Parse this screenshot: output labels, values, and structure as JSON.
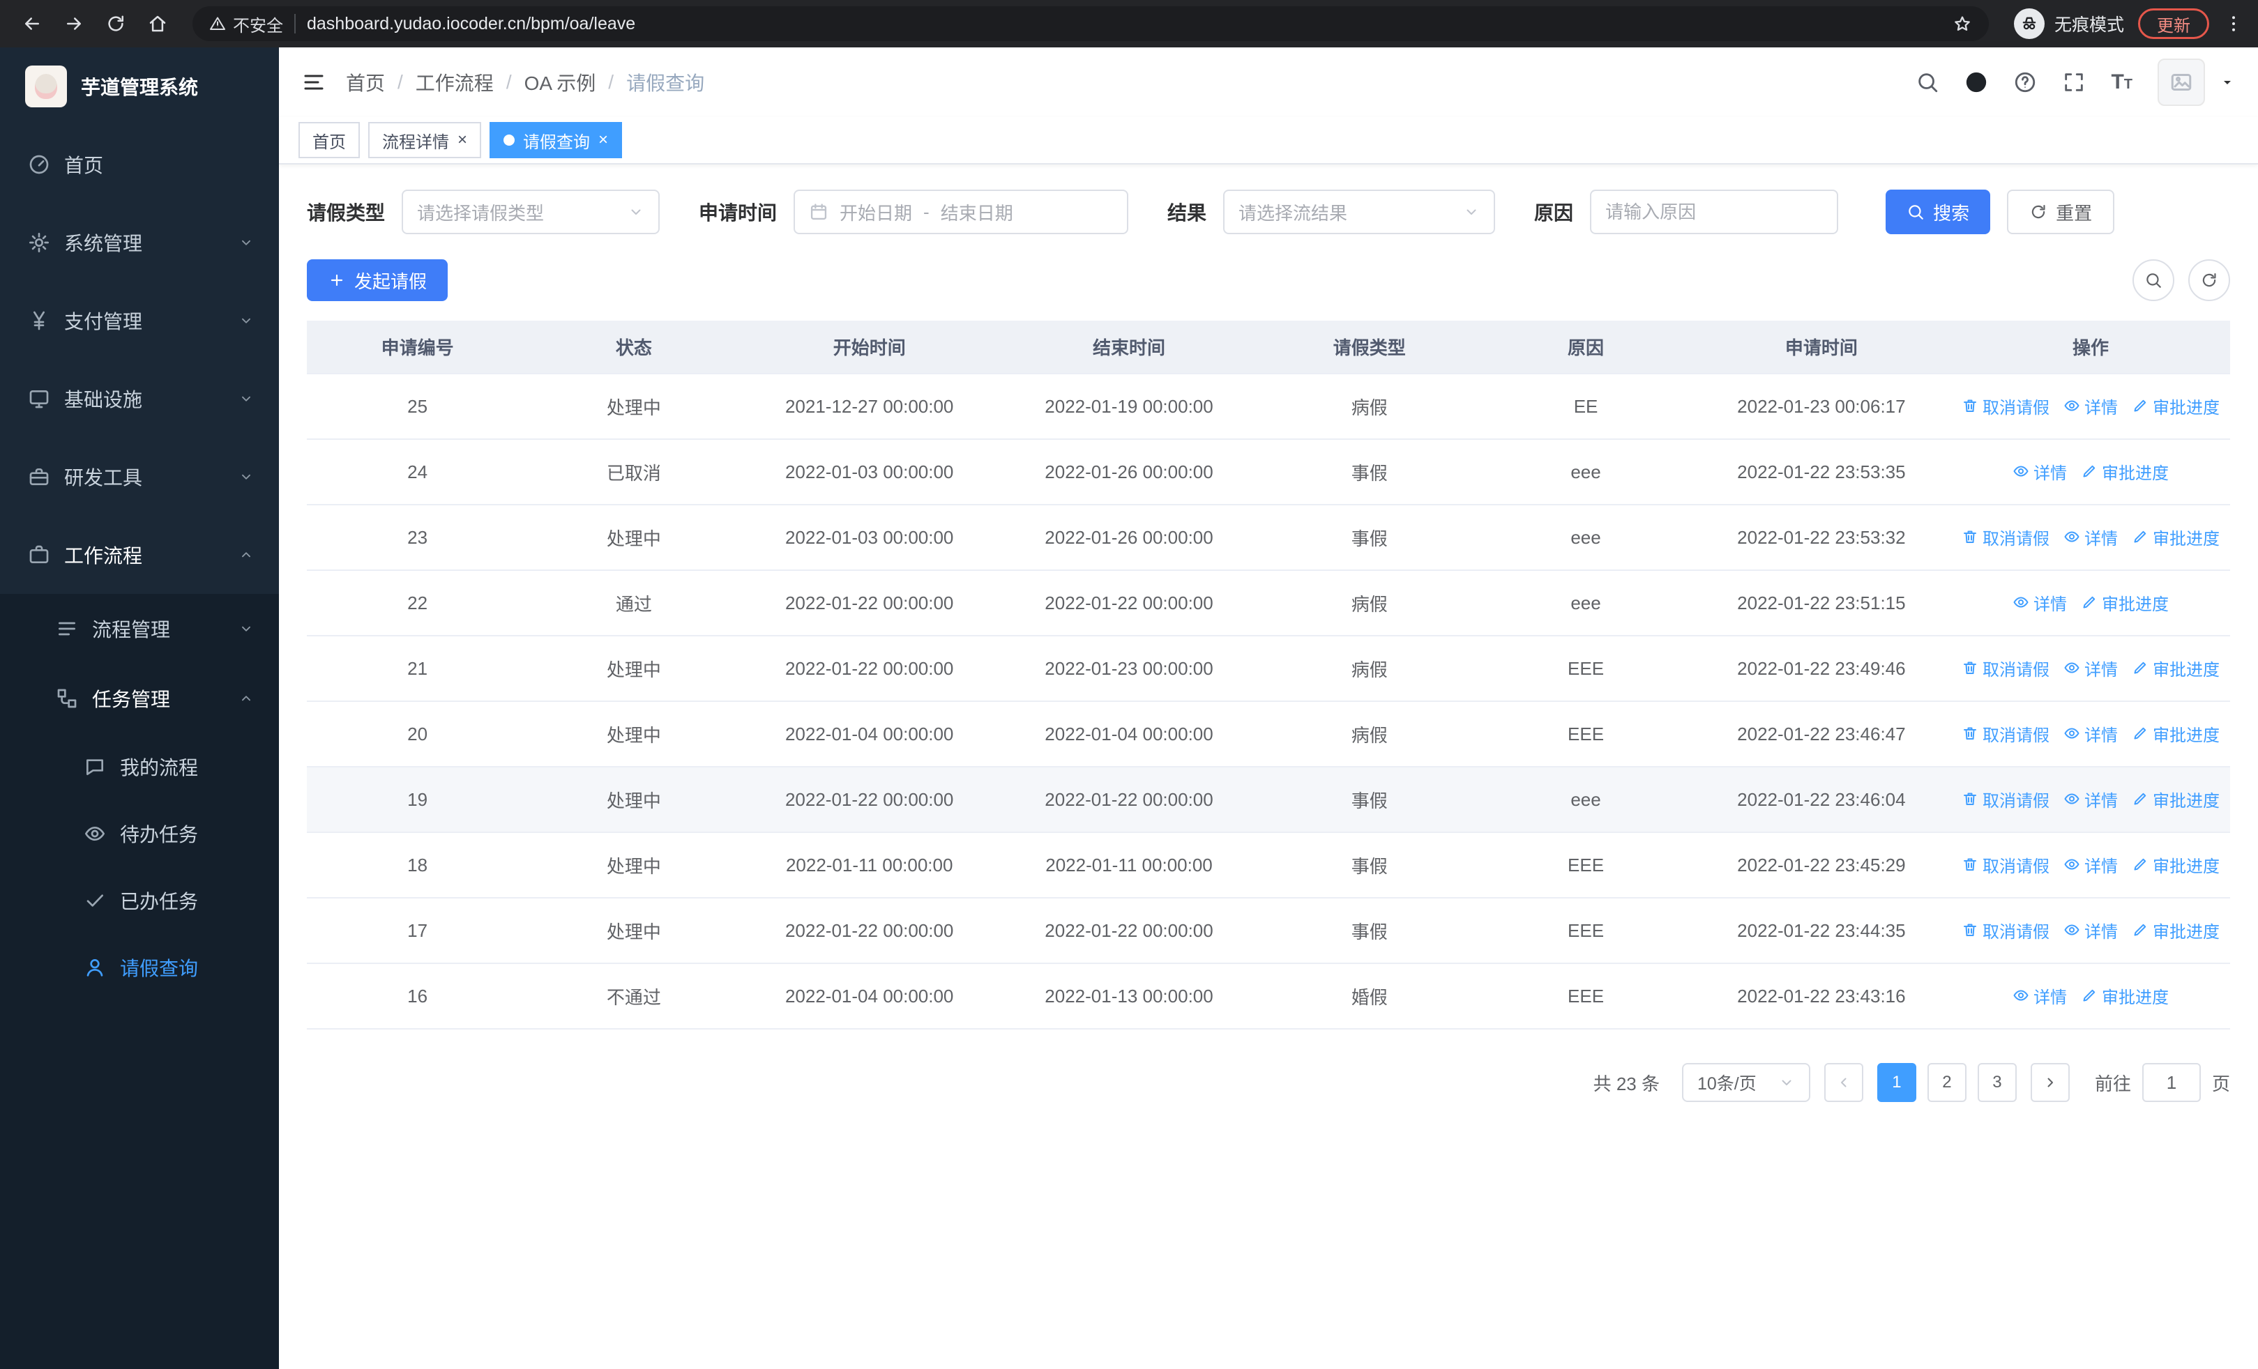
{
  "colors": {
    "primary": "#409eff",
    "button_blue": "#3f7df8",
    "sidebar_bg": "#141f2b",
    "sidebar_item_bg": "#1b2836",
    "tag_active": "#409eff",
    "update_badge": "#f28b82"
  },
  "browser": {
    "security_label": "不安全",
    "url": "dashboard.yudao.iocoder.cn/bpm/oa/leave",
    "incognito_label": "无痕模式",
    "update_label": "更新"
  },
  "sidebar": {
    "app_title": "芋道管理系统",
    "top_items": [
      {
        "label": "首页"
      },
      {
        "label": "系统管理"
      },
      {
        "label": "支付管理"
      },
      {
        "label": "基础设施"
      },
      {
        "label": "研发工具"
      },
      {
        "label": "工作流程"
      }
    ],
    "workflow_children": [
      {
        "label": "流程管理"
      },
      {
        "label": "任务管理"
      }
    ],
    "task_children": [
      {
        "label": "我的流程"
      },
      {
        "label": "待办任务"
      },
      {
        "label": "已办任务"
      },
      {
        "label": "请假查询"
      }
    ]
  },
  "header": {
    "breadcrumb": [
      "首页",
      "工作流程",
      "OA 示例",
      "请假查询"
    ],
    "separator": "/"
  },
  "tabs": [
    {
      "label": "首页"
    },
    {
      "label": "流程详情"
    },
    {
      "label": "请假查询"
    }
  ],
  "filters": {
    "leave_type_label": "请假类型",
    "leave_type_placeholder": "请选择请假类型",
    "apply_time_label": "申请时间",
    "start_date_placeholder": "开始日期",
    "range_separator": "-",
    "end_date_placeholder": "结束日期",
    "result_label": "结果",
    "result_placeholder": "请选择流结果",
    "reason_label": "原因",
    "reason_placeholder": "请输入原因",
    "search_button": "搜索",
    "reset_button": "重置"
  },
  "toolbar": {
    "create_button": "发起请假"
  },
  "table": {
    "columns": [
      "申请编号",
      "状态",
      "开始时间",
      "结束时间",
      "请假类型",
      "原因",
      "申请时间",
      "操作"
    ],
    "action_defs": {
      "cancel": {
        "label": "取消请假",
        "icon": "trash"
      },
      "detail": {
        "label": "详情",
        "icon": "eye"
      },
      "progress": {
        "label": "审批进度",
        "icon": "edit"
      }
    },
    "rows": [
      {
        "id": "25",
        "status": "处理中",
        "start": "2021-12-27 00:00:00",
        "end": "2022-01-19 00:00:00",
        "type": "病假",
        "reason": "EE",
        "applied": "2022-01-23 00:06:17",
        "actions": [
          "cancel",
          "detail",
          "progress"
        ]
      },
      {
        "id": "24",
        "status": "已取消",
        "start": "2022-01-03 00:00:00",
        "end": "2022-01-26 00:00:00",
        "type": "事假",
        "reason": "eee",
        "applied": "2022-01-22 23:53:35",
        "actions": [
          "detail",
          "progress"
        ]
      },
      {
        "id": "23",
        "status": "处理中",
        "start": "2022-01-03 00:00:00",
        "end": "2022-01-26 00:00:00",
        "type": "事假",
        "reason": "eee",
        "applied": "2022-01-22 23:53:32",
        "actions": [
          "cancel",
          "detail",
          "progress"
        ]
      },
      {
        "id": "22",
        "status": "通过",
        "start": "2022-01-22 00:00:00",
        "end": "2022-01-22 00:00:00",
        "type": "病假",
        "reason": "eee",
        "applied": "2022-01-22 23:51:15",
        "actions": [
          "detail",
          "progress"
        ]
      },
      {
        "id": "21",
        "status": "处理中",
        "start": "2022-01-22 00:00:00",
        "end": "2022-01-23 00:00:00",
        "type": "病假",
        "reason": "EEE",
        "applied": "2022-01-22 23:49:46",
        "actions": [
          "cancel",
          "detail",
          "progress"
        ]
      },
      {
        "id": "20",
        "status": "处理中",
        "start": "2022-01-04 00:00:00",
        "end": "2022-01-04 00:00:00",
        "type": "病假",
        "reason": "EEE",
        "applied": "2022-01-22 23:46:47",
        "actions": [
          "cancel",
          "detail",
          "progress"
        ]
      },
      {
        "id": "19",
        "status": "处理中",
        "start": "2022-01-22 00:00:00",
        "end": "2022-01-22 00:00:00",
        "type": "事假",
        "reason": "eee",
        "applied": "2022-01-22 23:46:04",
        "actions": [
          "cancel",
          "detail",
          "progress"
        ],
        "highlight": true
      },
      {
        "id": "18",
        "status": "处理中",
        "start": "2022-01-11 00:00:00",
        "end": "2022-01-11 00:00:00",
        "type": "事假",
        "reason": "EEE",
        "applied": "2022-01-22 23:45:29",
        "actions": [
          "cancel",
          "detail",
          "progress"
        ]
      },
      {
        "id": "17",
        "status": "处理中",
        "start": "2022-01-22 00:00:00",
        "end": "2022-01-22 00:00:00",
        "type": "事假",
        "reason": "EEE",
        "applied": "2022-01-22 23:44:35",
        "actions": [
          "cancel",
          "detail",
          "progress"
        ]
      },
      {
        "id": "16",
        "status": "不通过",
        "start": "2022-01-04 00:00:00",
        "end": "2022-01-13 00:00:00",
        "type": "婚假",
        "reason": "EEE",
        "applied": "2022-01-22 23:43:16",
        "actions": [
          "detail",
          "progress"
        ]
      }
    ]
  },
  "pagination": {
    "total_text": "共 23 条",
    "page_size": "10条/页",
    "pages": [
      "1",
      "2",
      "3"
    ],
    "active_page": "1",
    "goto_label": "前往",
    "goto_value": "1",
    "unit_label": "页"
  }
}
